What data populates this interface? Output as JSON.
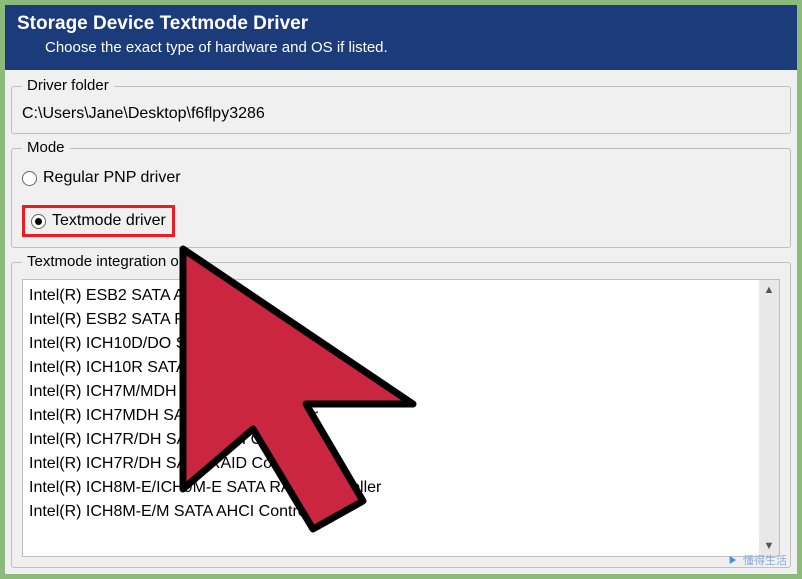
{
  "header": {
    "title": "Storage Device Textmode Driver",
    "subtitle": "Choose the exact type of hardware and OS if listed."
  },
  "driver_folder": {
    "legend": "Driver folder",
    "path": "C:\\Users\\Jane\\Desktop\\f6flpy3286"
  },
  "mode": {
    "legend": "Mode",
    "option_regular": "Regular PNP driver",
    "option_textmode": "Textmode driver"
  },
  "integration": {
    "legend": "Textmode integration opt",
    "items": [
      "Intel(R) ESB2 SATA AHCI Co",
      "Intel(R) ESB2 SATA RAID Cont",
      "Intel(R) ICH10D/DO SATA AHCI C",
      "Intel(R) ICH10R SATA AHCI Controller",
      "Intel(R) ICH7M/MDH SATA AHCI Contro",
      "Intel(R) ICH7MDH SATA RAID Controller",
      "Intel(R) ICH7R/DH SATA AHCI Controller",
      "Intel(R) ICH7R/DH SATA RAID Controller",
      "Intel(R) ICH8M-E/ICH9M-E SATA RAID Controller",
      "Intel(R) ICH8M-E/M SATA AHCI Controller"
    ]
  },
  "watermark": {
    "text": "懂得生活"
  }
}
